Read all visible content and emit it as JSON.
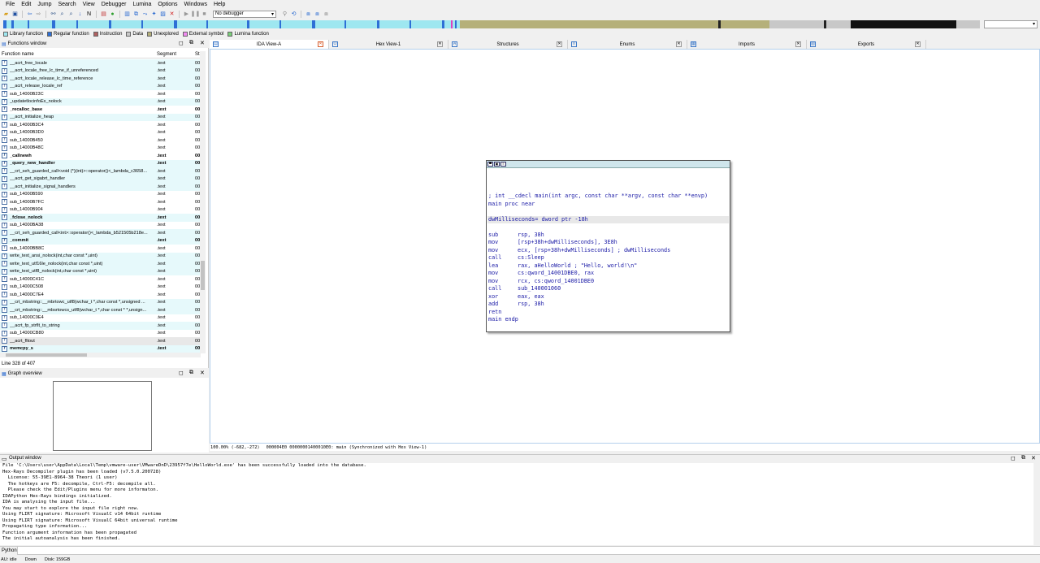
{
  "menu": [
    "File",
    "Edit",
    "Jump",
    "Search",
    "View",
    "Debugger",
    "Lumina",
    "Options",
    "Windows",
    "Help"
  ],
  "toolbar": {
    "debugger_select": "No debugger"
  },
  "legend": [
    {
      "label": "Library function",
      "color": "#9ee7f0"
    },
    {
      "label": "Regular function",
      "color": "#2d6fd6"
    },
    {
      "label": "Instruction",
      "color": "#b06060"
    },
    {
      "label": "Data",
      "color": "#c8c8c8"
    },
    {
      "label": "Unexplored",
      "color": "#b5b07a"
    },
    {
      "label": "External symbol",
      "color": "#f08af0"
    },
    {
      "label": "Lumina function",
      "color": "#7ad07a"
    }
  ],
  "functions_window": {
    "title": "Functions window",
    "columns": {
      "name": "Function name",
      "segment": "Segment",
      "start": "St"
    },
    "rows": [
      {
        "name": "__acrt_free_locale",
        "segment": ".text",
        "start": "00",
        "lib": true
      },
      {
        "name": "__acrt_locale_free_lc_time_if_unreferenced",
        "segment": ".text",
        "start": "00",
        "lib": true
      },
      {
        "name": "__acrt_locale_release_lc_time_reference",
        "segment": ".text",
        "start": "00",
        "lib": true
      },
      {
        "name": "__acrt_release_locale_ref",
        "segment": ".text",
        "start": "00",
        "lib": true
      },
      {
        "name": "sub_14000B23C",
        "segment": ".text",
        "start": "00"
      },
      {
        "name": "_updatetlocinfoEx_nolock",
        "segment": ".text",
        "start": "00",
        "lib": true
      },
      {
        "name": "_recalloc_base",
        "segment": ".text",
        "start": "00",
        "bold": true
      },
      {
        "name": "__acrt_initialize_heap",
        "segment": ".text",
        "start": "00",
        "lib": true
      },
      {
        "name": "sub_14000B3C4",
        "segment": ".text",
        "start": "00"
      },
      {
        "name": "sub_14000B3D0",
        "segment": ".text",
        "start": "00"
      },
      {
        "name": "sub_14000B450",
        "segment": ".text",
        "start": "00"
      },
      {
        "name": "sub_14000B48C",
        "segment": ".text",
        "start": "00"
      },
      {
        "name": "_callnewh",
        "segment": ".text",
        "start": "00",
        "bold": true
      },
      {
        "name": "_query_new_handler",
        "segment": ".text",
        "start": "00",
        "bold": true,
        "lib": true
      },
      {
        "name": "__crt_seh_guarded_call<void (*)(int)>::operator()<_lambda_c3658...",
        "segment": ".text",
        "start": "00",
        "lib": true
      },
      {
        "name": "__acrt_get_sigabrt_handler",
        "segment": ".text",
        "start": "00",
        "lib": true
      },
      {
        "name": "__acrt_initialize_signal_handlers",
        "segment": ".text",
        "start": "00",
        "lib": true
      },
      {
        "name": "sub_14000B590",
        "segment": ".text",
        "start": "00"
      },
      {
        "name": "sub_14000B7FC",
        "segment": ".text",
        "start": "00"
      },
      {
        "name": "sub_14000B904",
        "segment": ".text",
        "start": "00"
      },
      {
        "name": "_fclose_nolock",
        "segment": ".text",
        "start": "00",
        "bold": true,
        "lib": true
      },
      {
        "name": "sub_14000BA38",
        "segment": ".text",
        "start": "00"
      },
      {
        "name": "__crt_seh_guarded_call<int>::operator()<_lambda_b521505b218e...",
        "segment": ".text",
        "start": "00",
        "lib": true
      },
      {
        "name": "_commit",
        "segment": ".text",
        "start": "00",
        "bold": true,
        "lib": true
      },
      {
        "name": "sub_14000BB8C",
        "segment": ".text",
        "start": "00"
      },
      {
        "name": "write_text_ansi_nolock(int,char const *,uint)",
        "segment": ".text",
        "start": "00",
        "lib": true
      },
      {
        "name": "write_text_utf16le_nolock(int,char const *,uint)",
        "segment": ".text",
        "start": "00",
        "lib": true
      },
      {
        "name": "write_text_utf8_nolock(int,char const *,uint)",
        "segment": ".text",
        "start": "00",
        "lib": true
      },
      {
        "name": "sub_14000C41C",
        "segment": ".text",
        "start": "00"
      },
      {
        "name": "sub_14000C508",
        "segment": ".text",
        "start": "00"
      },
      {
        "name": "sub_14000C7E4",
        "segment": ".text",
        "start": "00"
      },
      {
        "name": "__crt_mbstring::__mbrtowc_utf8(wchar_t *,char const *,unsigned ...",
        "segment": ".text",
        "start": "00",
        "lib": true
      },
      {
        "name": "__crt_mbstring::__mbsrtowcs_utf8(wchar_t *,char const * *,unsign...",
        "segment": ".text",
        "start": "00",
        "lib": true
      },
      {
        "name": "sub_14000C9E4",
        "segment": ".text",
        "start": "00"
      },
      {
        "name": "__acrt_fp_strflt_to_string",
        "segment": ".text",
        "start": "00",
        "lib": true
      },
      {
        "name": "sub_14000CB80",
        "segment": ".text",
        "start": "00"
      },
      {
        "name": "__acrt_fltout",
        "segment": ".text",
        "start": "00",
        "sel": true
      },
      {
        "name": "memcpy_s",
        "segment": ".text",
        "start": "00",
        "bold": true,
        "lib": true
      }
    ],
    "status": "Line 328 of 407"
  },
  "graph_overview": {
    "title": "Graph overview"
  },
  "tabs": [
    {
      "label": "IDA View-A",
      "active": true
    },
    {
      "label": "Hex View-1"
    },
    {
      "label": "Structures"
    },
    {
      "label": "Enums"
    },
    {
      "label": "Imports"
    },
    {
      "label": "Exports"
    }
  ],
  "ida_status": {
    "zoom": "100.00% (-682,-272)",
    "location": "000004E0 00000001400010E0: main (Synchronized with Hex View-1)"
  },
  "asm": {
    "signature": "; int __cdecl main(int argc, const char **argv, const char **envp)",
    "proc": "main proc near",
    "var": "dwMilliseconds= dword ptr -18h",
    "lines": [
      {
        "mn": "sub",
        "ops": "rsp, 38h"
      },
      {
        "mn": "mov",
        "ops": "[rsp+38h+dwMilliseconds], 3E8h"
      },
      {
        "mn": "mov",
        "ops": "ecx, [rsp+38h+dwMilliseconds] ; dwMilliseconds"
      },
      {
        "mn": "call",
        "ops": "cs:Sleep"
      },
      {
        "mn": "lea",
        "ops": "rax, aHelloWorld ; \"Hello, world!\\n\""
      },
      {
        "mn": "mov",
        "ops": "cs:qword_14001DBE0, rax"
      },
      {
        "mn": "mov",
        "ops": "rcx, cs:qword_14001DBE0"
      },
      {
        "mn": "call",
        "ops": "sub_140001060"
      },
      {
        "mn": "xor",
        "ops": "eax, eax"
      },
      {
        "mn": "add",
        "ops": "rsp, 38h"
      },
      {
        "mn": "retn",
        "ops": ""
      }
    ],
    "endp": "main endp"
  },
  "output": {
    "title": "Output window",
    "lines": [
      "File 'C:\\Users\\user\\AppData\\Local\\Temp\\vmware-user\\VMwareDnD\\23957f7e\\HelloWorld.exe' has been successfully loaded into the database.",
      "Hex-Rays Decompiler plugin has been loaded (v7.5.0.200728)",
      "  License: 55-39E1-8964-38 Theori (1 user)",
      "  The hotkeys are F5: decompile, Ctrl-F5: decompile all.",
      "  Please check the Edit/Plugins menu for more informaton.",
      "IDAPython Hex-Rays bindings initialized.",
      "IDA is analysing the input file...",
      "You may start to explore the input file right now.",
      "Using FLIRT signature: Microsoft VisualC v14 64bit runtime",
      "Using FLIRT signature: Microsoft VisualC 64bit universal runtime",
      "Propagating type information...",
      "Function argument information has been propagated",
      "The initial autoanalysis has been finished."
    ],
    "python_label": "Python"
  },
  "status": {
    "au": "AU:  idle",
    "dir": "Down",
    "disk": "Disk: 159GB"
  }
}
